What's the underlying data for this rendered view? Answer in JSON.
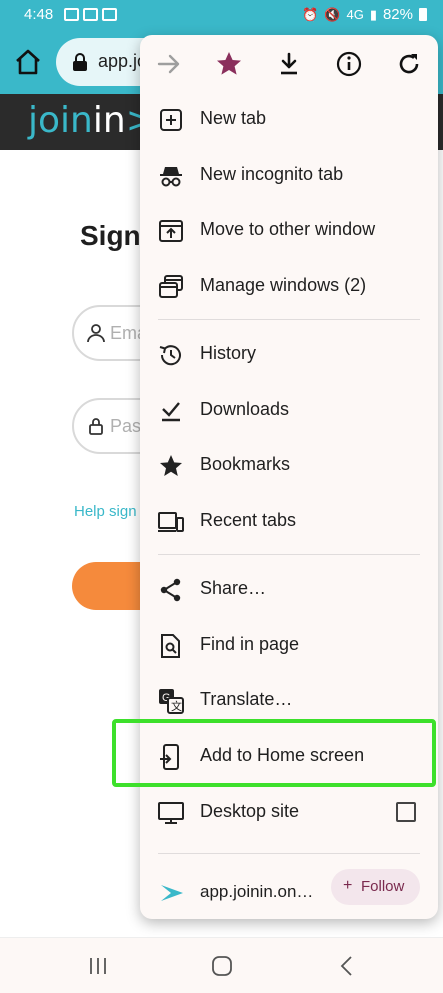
{
  "status_bar": {
    "time": "4:48",
    "network": "4G",
    "battery": "82%"
  },
  "browser": {
    "url": "app.jo",
    "lock_icon": "lock-icon",
    "home_icon": "home-icon"
  },
  "page": {
    "logo_join": "join",
    "logo_in": "in",
    "logo_arrow": ">",
    "title": "Sign",
    "email_placeholder": "Ema",
    "password_placeholder": "Pas",
    "help_link": "Help sign",
    "colors": {
      "brand_teal": "#3ab8c9",
      "header_dark": "#2b2b2b",
      "signin_orange": "#f58a3c"
    }
  },
  "menu": {
    "toolbar_icons": [
      "forward-icon",
      "bookmark-star-icon",
      "download-icon",
      "info-icon",
      "reload-icon"
    ],
    "items": [
      {
        "label": "New tab",
        "icon": "new-tab-icon"
      },
      {
        "label": "New incognito tab",
        "icon": "incognito-icon"
      },
      {
        "label": "Move to other window",
        "icon": "move-window-icon"
      },
      {
        "label": "Manage windows (2)",
        "icon": "manage-windows-icon"
      },
      {
        "label": "History",
        "icon": "history-icon"
      },
      {
        "label": "Downloads",
        "icon": "downloads-icon"
      },
      {
        "label": "Bookmarks",
        "icon": "bookmarks-icon"
      },
      {
        "label": "Recent tabs",
        "icon": "recent-tabs-icon"
      },
      {
        "label": "Share…",
        "icon": "share-icon"
      },
      {
        "label": "Find in page",
        "icon": "find-in-page-icon"
      },
      {
        "label": "Translate…",
        "icon": "translate-icon"
      },
      {
        "label": "Add to Home screen",
        "icon": "add-to-home-icon"
      },
      {
        "label": "Desktop site",
        "icon": "desktop-icon"
      }
    ],
    "site": {
      "url": "app.joinin.on…",
      "follow_label": "Follow",
      "follow_plus": "+"
    },
    "highlight_color": "#3de02b"
  },
  "nav_bar": {
    "icons": [
      "recent-apps-icon",
      "home-nav-icon",
      "back-icon"
    ]
  }
}
